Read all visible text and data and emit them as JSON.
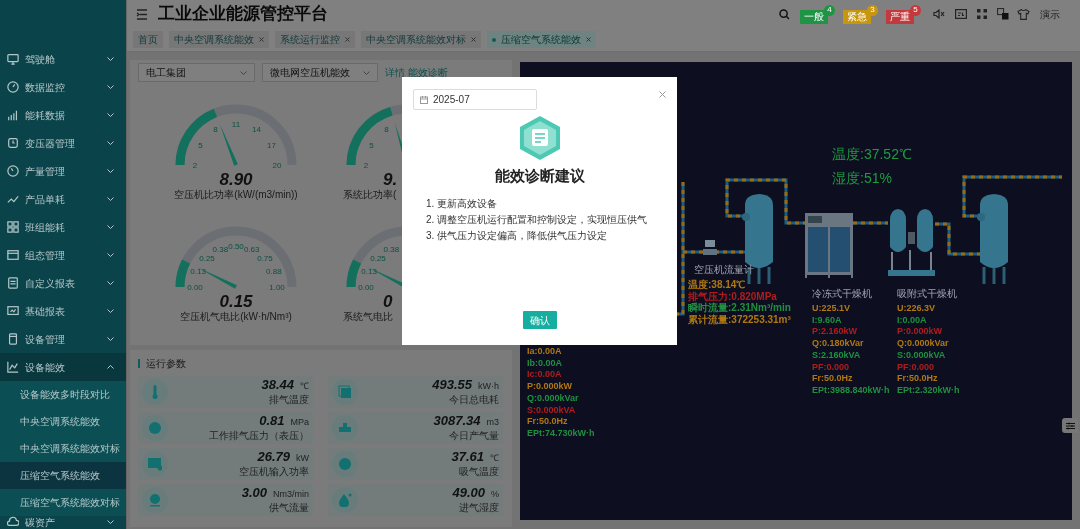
{
  "app": {
    "title": "工业企业能源管控平台",
    "user": "演示"
  },
  "alarms": [
    {
      "label": "一般",
      "count": "4",
      "color": "#1e9444"
    },
    {
      "label": "紧急",
      "count": "3",
      "color": "#c8960e"
    },
    {
      "label": "严重",
      "count": "5",
      "color": "#c23a3e"
    }
  ],
  "sidebar": {
    "items": [
      {
        "label": "驾驶舱",
        "expanded": false
      },
      {
        "label": "数据监控",
        "expanded": false
      },
      {
        "label": "能耗数据",
        "expanded": false
      },
      {
        "label": "变压器管理",
        "expanded": false
      },
      {
        "label": "产量管理",
        "expanded": false
      },
      {
        "label": "产品单耗",
        "expanded": false
      },
      {
        "label": "班组能耗",
        "expanded": false
      },
      {
        "label": "组态管理",
        "expanded": false
      },
      {
        "label": "自定义报表",
        "expanded": false
      },
      {
        "label": "基础报表",
        "expanded": false
      },
      {
        "label": "设备管理",
        "expanded": false
      },
      {
        "label": "设备能效",
        "expanded": true,
        "children": [
          {
            "label": "设备能效多时段对比",
            "selected": false
          },
          {
            "label": "中央空调系统能效",
            "selected": false
          },
          {
            "label": "中央空调系统能效对标",
            "selected": false
          },
          {
            "label": "压缩空气系统能效",
            "selected": true
          },
          {
            "label": "压缩空气系统能效对标",
            "selected": false
          }
        ]
      },
      {
        "label": "碳资产",
        "expanded": false
      }
    ]
  },
  "tabs": [
    {
      "label": "首页",
      "selected": false,
      "closable": false
    },
    {
      "label": "中央空调系统能效",
      "selected": false,
      "closable": true
    },
    {
      "label": "系统运行监控",
      "selected": false,
      "closable": true
    },
    {
      "label": "中央空调系统能效对标",
      "selected": false,
      "closable": true
    },
    {
      "label": "压缩空气系统能效",
      "selected": true,
      "closable": true
    }
  ],
  "filters": {
    "company": "电工集团",
    "scheme": "微电网空压机能效",
    "links": [
      "详情",
      "能效诊断"
    ]
  },
  "gauges": [
    {
      "value": "8.90",
      "label": "空压机比功率(kW/(m3/min))",
      "ticks": [
        "2",
        "5",
        "8",
        "11",
        "14",
        "17",
        "20"
      ]
    },
    {
      "value": "9.",
      "label": "系统比功率(",
      "ticks": [
        "2",
        "5",
        "8"
      ]
    },
    {
      "value": "0.15",
      "label": "空压机气电比(kW·h/Nm³)",
      "ticks": [
        "0.00",
        "0.13",
        "0.25",
        "0.38",
        "0.50",
        "0.63",
        "0.75",
        "0.88",
        "1.00"
      ]
    },
    {
      "value": "0",
      "label": "系统气电比",
      "ticks": [
        "0.00",
        "0.13",
        "0.25",
        "0.38"
      ]
    }
  ],
  "params": {
    "title": "运行参数",
    "items": [
      {
        "value": "38.44",
        "unit": "℃",
        "label": "排气温度"
      },
      {
        "value": "493.55",
        "unit": "kW·h",
        "label": "今日总电耗"
      },
      {
        "value": "0.81",
        "unit": "MPa",
        "label": "工作排气压力（表压）"
      },
      {
        "value": "3087.34",
        "unit": "m3",
        "label": "今日产气量"
      },
      {
        "value": "26.79",
        "unit": "kW",
        "label": "空压机输入功率"
      },
      {
        "value": "37.61",
        "unit": "℃",
        "label": "吸气温度"
      },
      {
        "value": "3.00",
        "unit": "Nm3/min",
        "label": "供气流量"
      },
      {
        "value": "49.00",
        "unit": "%",
        "label": "进气湿度"
      }
    ]
  },
  "diagram": {
    "temperature": "温度:37.52℃",
    "humidity": "湿度:51%",
    "readouts": [
      {
        "lines": [
          {
            "text": "Ia:0.00A",
            "color": "#b07810"
          },
          {
            "text": "Ib:0.00A",
            "color": "#209040"
          },
          {
            "text": "Ic:0.00A",
            "color": "#b01c1c"
          },
          {
            "text": "P:0.000kW",
            "color": "#b07810"
          },
          {
            "text": "Q:0.000kVar",
            "color": "#209040"
          },
          {
            "text": "S:0.000kVA",
            "color": "#b01c1c"
          },
          {
            "text": "Fr:50.0Hz",
            "color": "#b07810"
          },
          {
            "text": "EPt:74.730kW·h",
            "color": "#209040"
          }
        ]
      },
      {
        "title": "空压机流量计",
        "lines": [
          {
            "text": "温度:38.14℃",
            "color": "#b07810"
          },
          {
            "text": "排气压力:0.820MPa",
            "color": "#b01c1c"
          },
          {
            "text": "瞬时流量:2.31Nm³/min",
            "color": "#209040"
          },
          {
            "text": "累计流量:372253.31m³",
            "color": "#b07810"
          }
        ]
      },
      {
        "title": "冷冻式干燥机",
        "lines": [
          {
            "text": "U:225.1V",
            "color": "#b07810"
          },
          {
            "text": "I:9.60A",
            "color": "#209040"
          },
          {
            "text": "P:2.160kW",
            "color": "#b01c1c"
          },
          {
            "text": "Q:0.180kVar",
            "color": "#b07810"
          },
          {
            "text": "S:2.160kVA",
            "color": "#209040"
          },
          {
            "text": "PF:0.000",
            "color": "#b01c1c"
          },
          {
            "text": "Fr:50.0Hz",
            "color": "#b07810"
          },
          {
            "text": "EPt:3988.840kW·h",
            "color": "#209040"
          }
        ]
      },
      {
        "title": "吸附式干燥机",
        "lines": [
          {
            "text": "U:226.3V",
            "color": "#b07810"
          },
          {
            "text": "I:0.00A",
            "color": "#209040"
          },
          {
            "text": "P:0.000kW",
            "color": "#b01c1c"
          },
          {
            "text": "Q:0.000kVar",
            "color": "#b07810"
          },
          {
            "text": "S:0.000kVA",
            "color": "#209040"
          },
          {
            "text": "PF:0.000",
            "color": "#b01c1c"
          },
          {
            "text": "Fr:50.0Hz",
            "color": "#b07810"
          },
          {
            "text": "EPt:2.320kW·h",
            "color": "#209040"
          }
        ]
      }
    ]
  },
  "dialog": {
    "date": "2025-07",
    "title": "能效诊断建议",
    "suggestions": [
      "1. 更新高效设备",
      "2. 调整空压机运行配置和控制设定，实现恒压供气",
      "3. 供气压力设定偏高，降低供气压力设定"
    ],
    "confirm": "确认"
  }
}
